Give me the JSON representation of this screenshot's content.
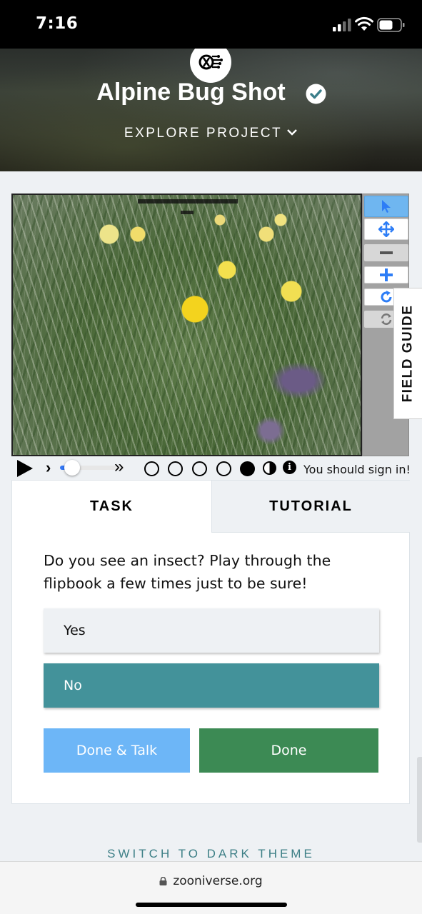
{
  "status_bar": {
    "time": "7:16"
  },
  "header": {
    "project_title": "Alpine Bug Shot",
    "explore_label": "EXPLORE PROJECT",
    "logo_icon": "zooniverse-bug-logo",
    "verified_icon": "verified-check-icon"
  },
  "viewer": {
    "tools": [
      {
        "name": "pointer",
        "icon": "cursor-arrow-icon",
        "active": true
      },
      {
        "name": "pan",
        "icon": "move-arrows-icon",
        "active": false
      },
      {
        "name": "zoom-out",
        "icon": "minus-icon",
        "active": false
      },
      {
        "name": "zoom-in",
        "icon": "plus-icon",
        "active": false
      },
      {
        "name": "rotate",
        "icon": "rotate-icon",
        "active": false
      },
      {
        "name": "reset",
        "icon": "reset-icon",
        "active": false
      }
    ],
    "field_guide_label": "FIELD GUIDE"
  },
  "flipbook": {
    "frame_count": 5,
    "current_frame": 5,
    "speed_fraction": 0.1,
    "sign_in_notice": "You should sign in!"
  },
  "task_panel": {
    "tabs": [
      {
        "label": "TASK",
        "active": true
      },
      {
        "label": "TUTORIAL",
        "active": false
      }
    ],
    "question": "Do you see an insect? Play through the flipbook a few times just to be sure!",
    "answers": [
      {
        "label": "Yes",
        "selected": false
      },
      {
        "label": "No",
        "selected": true
      }
    ],
    "done_talk_label": "Done & Talk",
    "done_label": "Done"
  },
  "footer": {
    "dark_theme_label": "SWITCH TO DARK THEME"
  },
  "browser": {
    "url": "zooniverse.org"
  },
  "colors": {
    "accent_teal": "#43929a",
    "done_green": "#3c8a54",
    "talk_blue": "#6db6f7",
    "tool_active_blue": "#6fb6f0"
  }
}
